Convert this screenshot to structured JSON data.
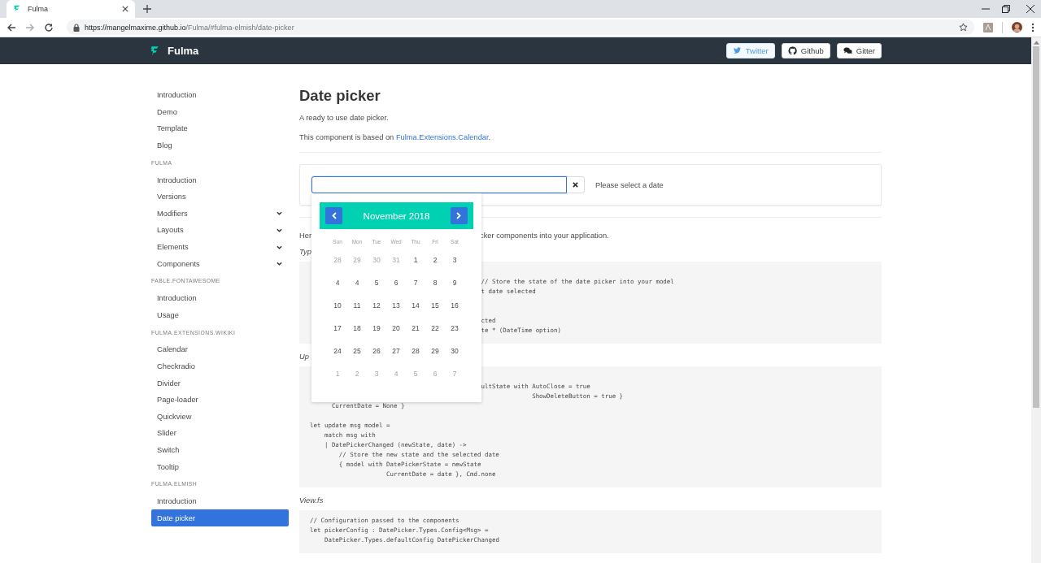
{
  "browser": {
    "tab": {
      "title": "Fulma"
    },
    "url": {
      "host": "https://mangelmaxime.github.io",
      "path": "/Fulma/#fulma-elmish/date-picker"
    }
  },
  "navbar": {
    "brand": "Fulma",
    "buttons": [
      {
        "label": "Twitter",
        "kind": "twitter"
      },
      {
        "label": "Github",
        "kind": "github"
      },
      {
        "label": "Gitter",
        "kind": "gitter"
      }
    ]
  },
  "sidebar": {
    "sections": [
      {
        "items": [
          {
            "label": "Introduction",
            "selected": false,
            "expandable": false
          },
          {
            "label": "Demo",
            "selected": false,
            "expandable": false
          },
          {
            "label": "Template",
            "selected": false,
            "expandable": false
          },
          {
            "label": "Blog",
            "selected": false,
            "expandable": false
          }
        ]
      },
      {
        "heading": "FULMA",
        "items": [
          {
            "label": "Introduction",
            "selected": false,
            "expandable": false
          },
          {
            "label": "Versions",
            "selected": false,
            "expandable": false
          },
          {
            "label": "Modifiers",
            "selected": false,
            "expandable": true
          },
          {
            "label": "Layouts",
            "selected": false,
            "expandable": true
          },
          {
            "label": "Elements",
            "selected": false,
            "expandable": true
          },
          {
            "label": "Components",
            "selected": false,
            "expandable": true
          }
        ]
      },
      {
        "heading": "FABLE.FONTAWESOME",
        "items": [
          {
            "label": "Introduction",
            "selected": false,
            "expandable": false
          },
          {
            "label": "Usage",
            "selected": false,
            "expandable": false
          }
        ]
      },
      {
        "heading": "FULMA.EXTENSIONS.WIKIKI",
        "items": [
          {
            "label": "Calendar",
            "selected": false,
            "expandable": false
          },
          {
            "label": "Checkradio",
            "selected": false,
            "expandable": false
          },
          {
            "label": "Divider",
            "selected": false,
            "expandable": false
          },
          {
            "label": "Page-loader",
            "selected": false,
            "expandable": false
          },
          {
            "label": "Quickview",
            "selected": false,
            "expandable": false
          },
          {
            "label": "Slider",
            "selected": false,
            "expandable": false
          },
          {
            "label": "Switch",
            "selected": false,
            "expandable": false
          },
          {
            "label": "Tooltip",
            "selected": false,
            "expandable": false
          }
        ]
      },
      {
        "heading": "FULMA.ELMISH",
        "items": [
          {
            "label": "Introduction",
            "selected": false,
            "expandable": false
          },
          {
            "label": "Date picker",
            "selected": true,
            "expandable": false
          }
        ]
      }
    ]
  },
  "page": {
    "title": "Date picker",
    "lead": "A ready to use date picker.",
    "based_on": {
      "text": "This component is based on ",
      "link": "Fulma.Extensions.Calendar",
      "end": "."
    }
  },
  "demo": {
    "input": {
      "focused": true
    },
    "message": "Please select a date",
    "calendar": {
      "month": "November 2018",
      "weekdays": [
        "Sun",
        "Mon",
        "Tue",
        "Wed",
        "Thu",
        "Fri",
        "Sat"
      ],
      "weeks": [
        [
          {
            "day": "28",
            "muted": true
          },
          {
            "day": "29",
            "muted": true
          },
          {
            "day": "30",
            "muted": true
          },
          {
            "day": "31",
            "muted": true
          },
          {
            "day": "1",
            "muted": false
          },
          {
            "day": "2",
            "muted": false
          },
          {
            "day": "3",
            "muted": false
          }
        ],
        [
          {
            "day": "4",
            "muted": false
          },
          {
            "day": "4",
            "muted": false
          },
          {
            "day": "5",
            "muted": false
          },
          {
            "day": "6",
            "muted": false
          },
          {
            "day": "7",
            "muted": false
          },
          {
            "day": "8",
            "muted": false
          },
          {
            "day": "9",
            "muted": false
          }
        ],
        [
          {
            "day": "10",
            "muted": false
          },
          {
            "day": "11",
            "muted": false
          },
          {
            "day": "12",
            "muted": false
          },
          {
            "day": "13",
            "muted": false
          },
          {
            "day": "14",
            "muted": false
          },
          {
            "day": "15",
            "muted": false
          },
          {
            "day": "16",
            "muted": false
          }
        ],
        [
          {
            "day": "17",
            "muted": false
          },
          {
            "day": "18",
            "muted": false
          },
          {
            "day": "19",
            "muted": false
          },
          {
            "day": "20",
            "muted": false
          },
          {
            "day": "21",
            "muted": false
          },
          {
            "day": "22",
            "muted": false
          },
          {
            "day": "23",
            "muted": false
          }
        ],
        [
          {
            "day": "24",
            "muted": false
          },
          {
            "day": "25",
            "muted": false
          },
          {
            "day": "26",
            "muted": false
          },
          {
            "day": "27",
            "muted": false
          },
          {
            "day": "28",
            "muted": false
          },
          {
            "day": "29",
            "muted": false
          },
          {
            "day": "30",
            "muted": false
          }
        ],
        [
          {
            "day": "1",
            "muted": true
          },
          {
            "day": "2",
            "muted": true
          },
          {
            "day": "3",
            "muted": true
          },
          {
            "day": "4",
            "muted": true
          },
          {
            "day": "5",
            "muted": true
          },
          {
            "day": "6",
            "muted": true
          },
          {
            "day": "7",
            "muted": true
          }
        ]
      ]
    }
  },
  "sections": [
    {
      "kind": "paragraph",
      "parts": [
        "Her",
        "cker components into your application."
      ]
    },
    {
      "kind": "file_label",
      "text": "Typ"
    },
    {
      "kind": "code",
      "groups": [
        [
          "                                               // Store the state of the date picker into your model",
          "                                               t date selected"
        ],
        [
          "                                               cted",
          "                                               te * (DateTime option)"
        ]
      ]
    },
    {
      "kind": "file_label",
      "text": "Up"
    },
    {
      "kind": "code",
      "groups": [
        [
          "                                               ultState with AutoClose = true",
          "                                                             ShowDeleteButton = true }",
          "      CurrentDate = None }"
        ],
        [
          "let update msg model =",
          "    match msg with",
          "    | DatePickerChanged (newState, date) ->",
          "        // Store the new state and the selected date",
          "        { model with DatePickerState = newState",
          "                     CurrentDate = date }, Cmd.none"
        ]
      ]
    },
    {
      "kind": "file_label",
      "text": "View.fs"
    },
    {
      "kind": "code",
      "groups": [
        [
          "// Configuration passed to the components",
          "let pickerConfig : DatePicker.Types.Config<Msg> =",
          "    DatePicker.Types.defaultConfig DatePickerChanged"
        ]
      ]
    }
  ]
}
